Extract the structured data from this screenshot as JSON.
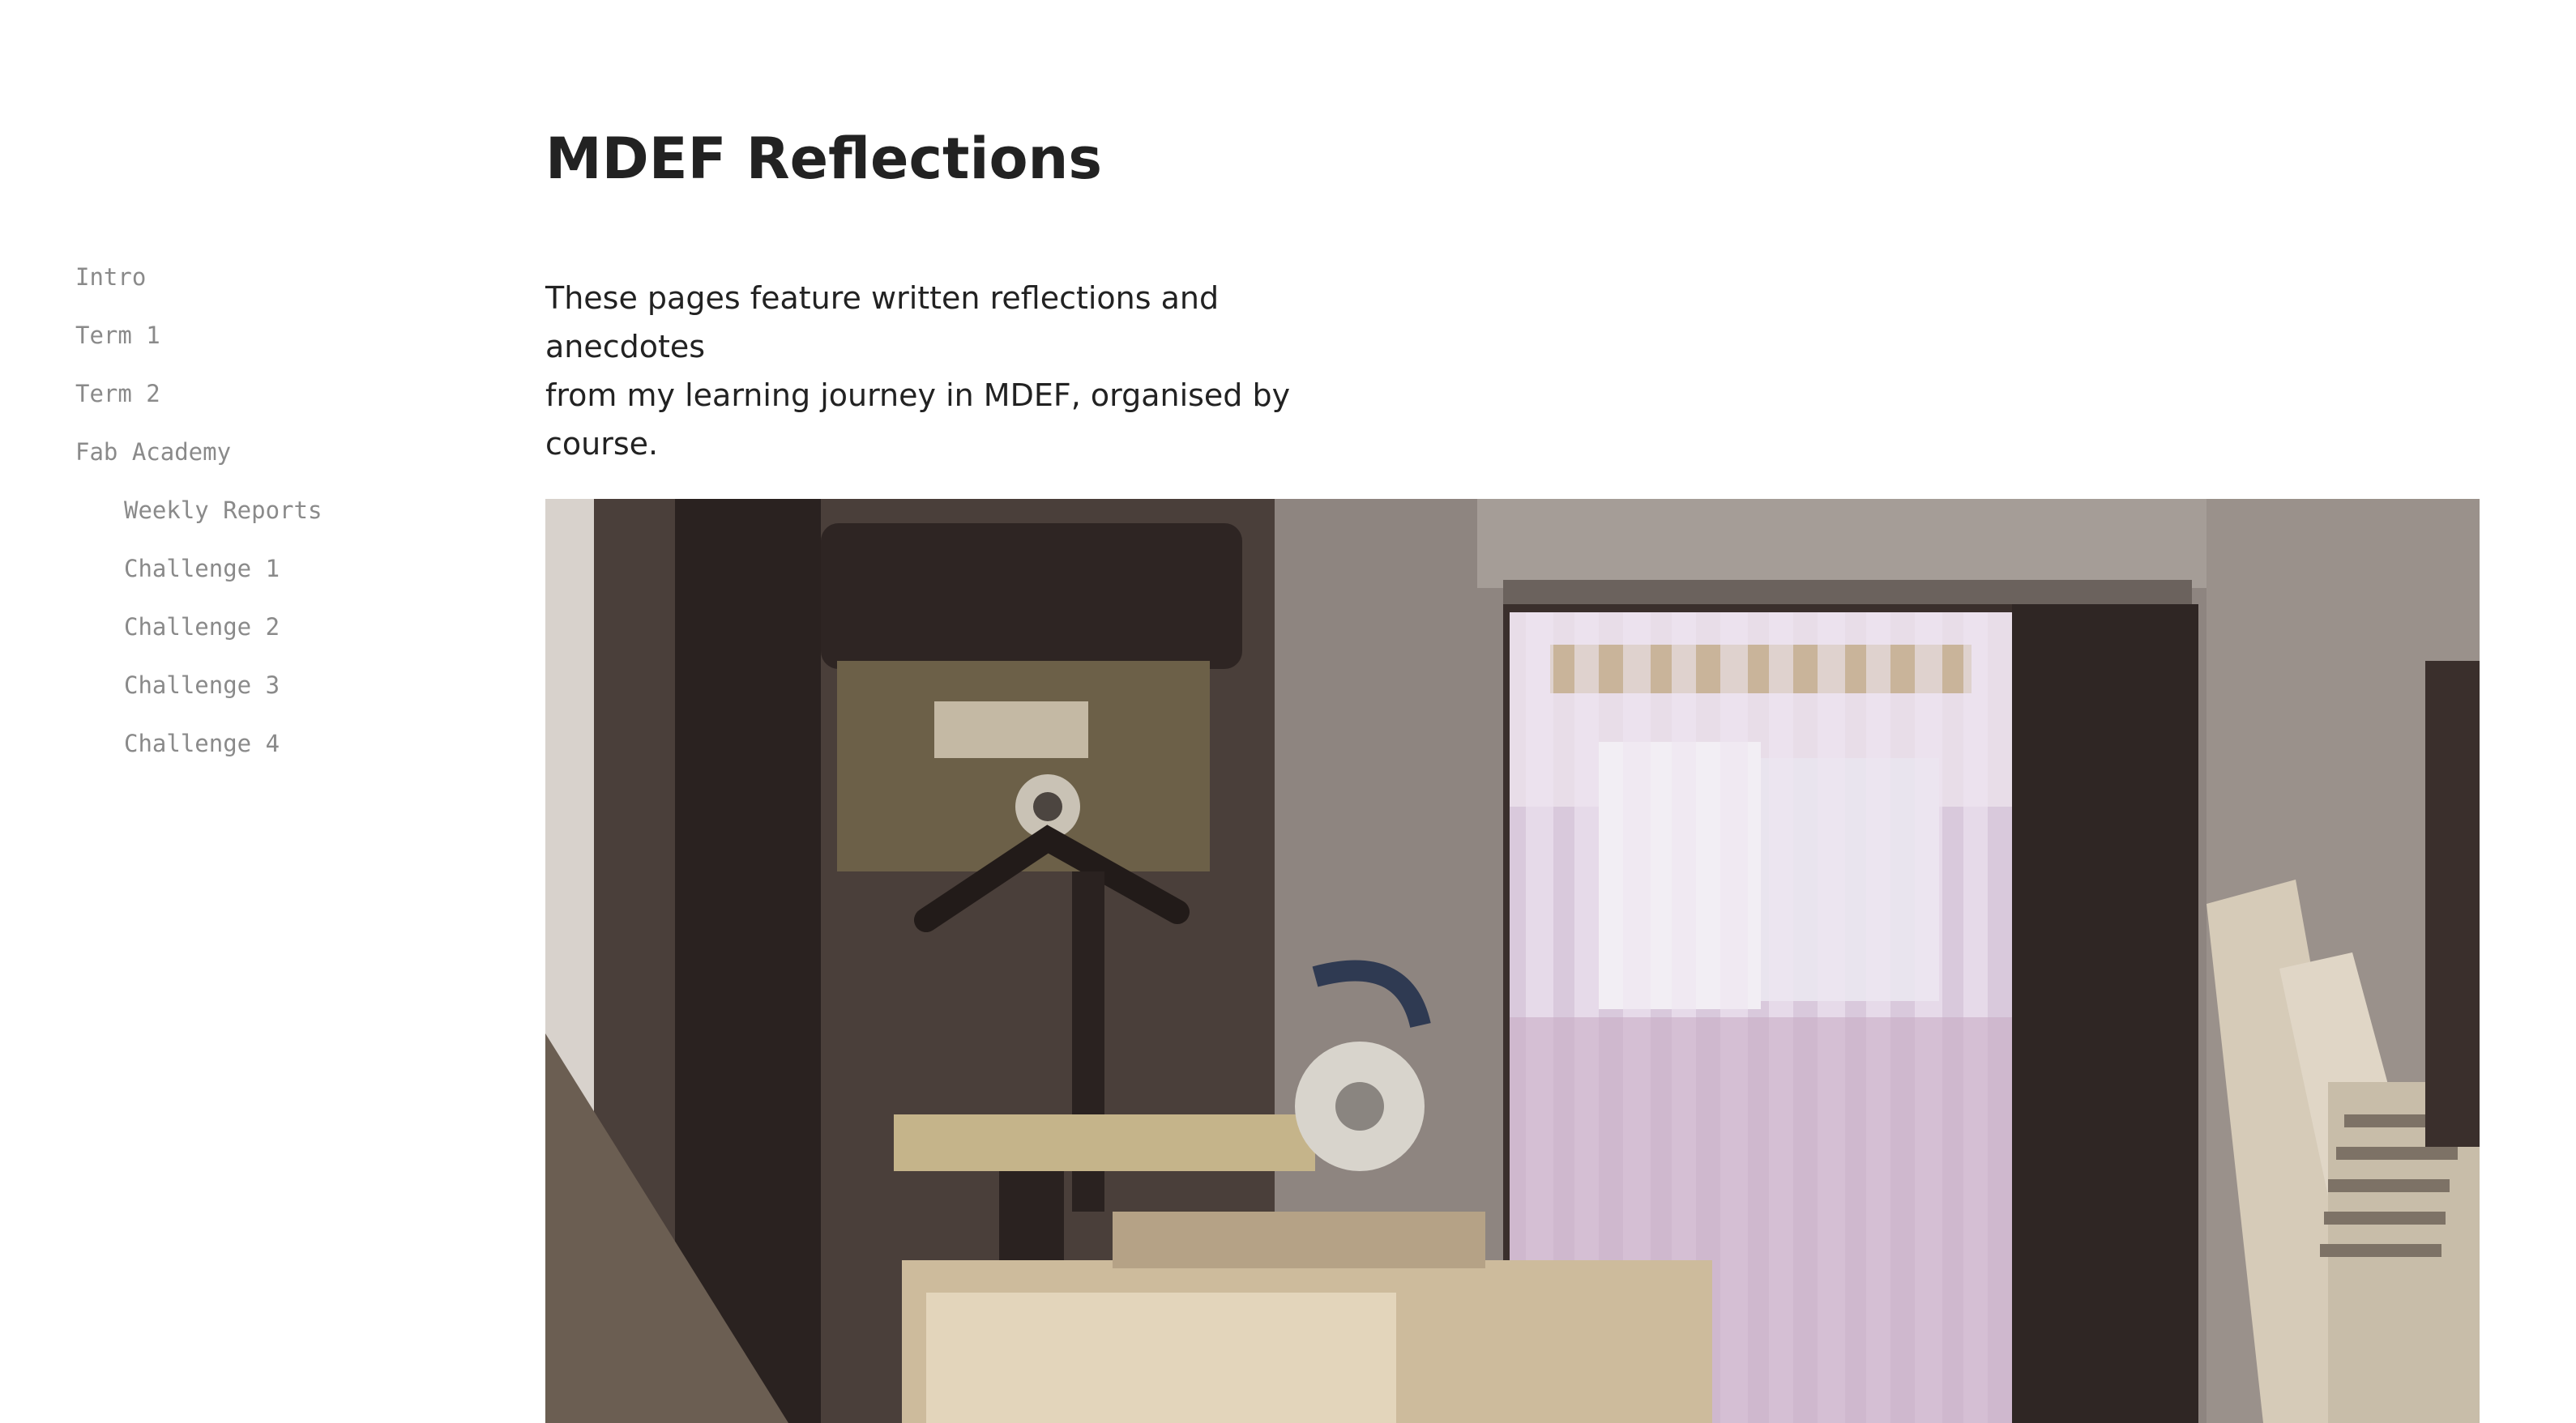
{
  "nav": {
    "items": [
      {
        "label": "Intro",
        "level": 0
      },
      {
        "label": "Term 1",
        "level": 0
      },
      {
        "label": "Term 2",
        "level": 0
      },
      {
        "label": "Fab Academy",
        "level": 0
      },
      {
        "label": "Weekly Reports",
        "level": 1
      },
      {
        "label": "Challenge 1",
        "level": 1
      },
      {
        "label": "Challenge 2",
        "level": 1
      },
      {
        "label": "Challenge 3",
        "level": 1
      },
      {
        "label": "Challenge 4",
        "level": 1
      }
    ]
  },
  "page": {
    "title": "MDEF Reflections",
    "intro_line1": "These pages feature written reflections and anecdotes",
    "intro_line2": "from my learning journey in MDEF, organised by course."
  },
  "hero": {
    "icon": "workshop-photo"
  },
  "colors": {
    "text": "#222222",
    "nav_text": "#8a8a8a",
    "background": "#ffffff"
  }
}
